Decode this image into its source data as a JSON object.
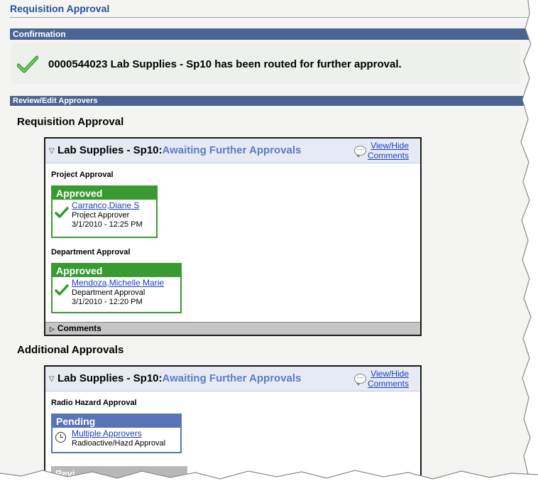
{
  "page": {
    "title": "Requisition Approval"
  },
  "confirmation": {
    "bar_label": "Confirmation",
    "message": "0000544023 Lab Supplies - Sp10 has been routed for further approval."
  },
  "review": {
    "bar_label": "Review/Edit Approvers"
  },
  "sections": [
    {
      "heading": "Requisition Approval",
      "panel": {
        "title": "Lab Supplies - Sp10:",
        "status": "Awaiting Further Approvals",
        "link_line1": "View/Hide",
        "link_line2": "Comments",
        "stages": [
          {
            "label": "Project Approval",
            "status": "Approved",
            "approver": "Carranco,Diane S",
            "role": "Project Approver",
            "datetime": "3/1/2010 - 12:25 PM"
          },
          {
            "label": "Department Approval",
            "status": "Approved",
            "approver": "Mendoza,Michelle Marie",
            "role": "Department Approval",
            "datetime": "3/1/2010 - 12:20 PM"
          }
        ],
        "comments_label": "Comments"
      }
    },
    {
      "heading": "Additional Approvals",
      "panel": {
        "title": "Lab Supplies - Sp10:",
        "status": "Awaiting Further Approvals",
        "link_line1": "View/Hide",
        "link_line2": "Comments",
        "stages": [
          {
            "label": "Radio Hazard Approval",
            "status": "Pending",
            "approver": "Multiple Approvers",
            "role": "Radioactive/Hazd Approval"
          }
        ],
        "partial_label": "Revi"
      }
    }
  ],
  "colors": {
    "section_bar": "#4b6393",
    "approved": "#3a9a32",
    "pending": "#5a72b8",
    "link": "#1d3fc4",
    "status_text": "#5c7dbf"
  },
  "icons": {
    "approved": "check-icon",
    "pending": "clock-icon",
    "comment": "speech-bubble-icon",
    "expand": "triangle-icon"
  }
}
